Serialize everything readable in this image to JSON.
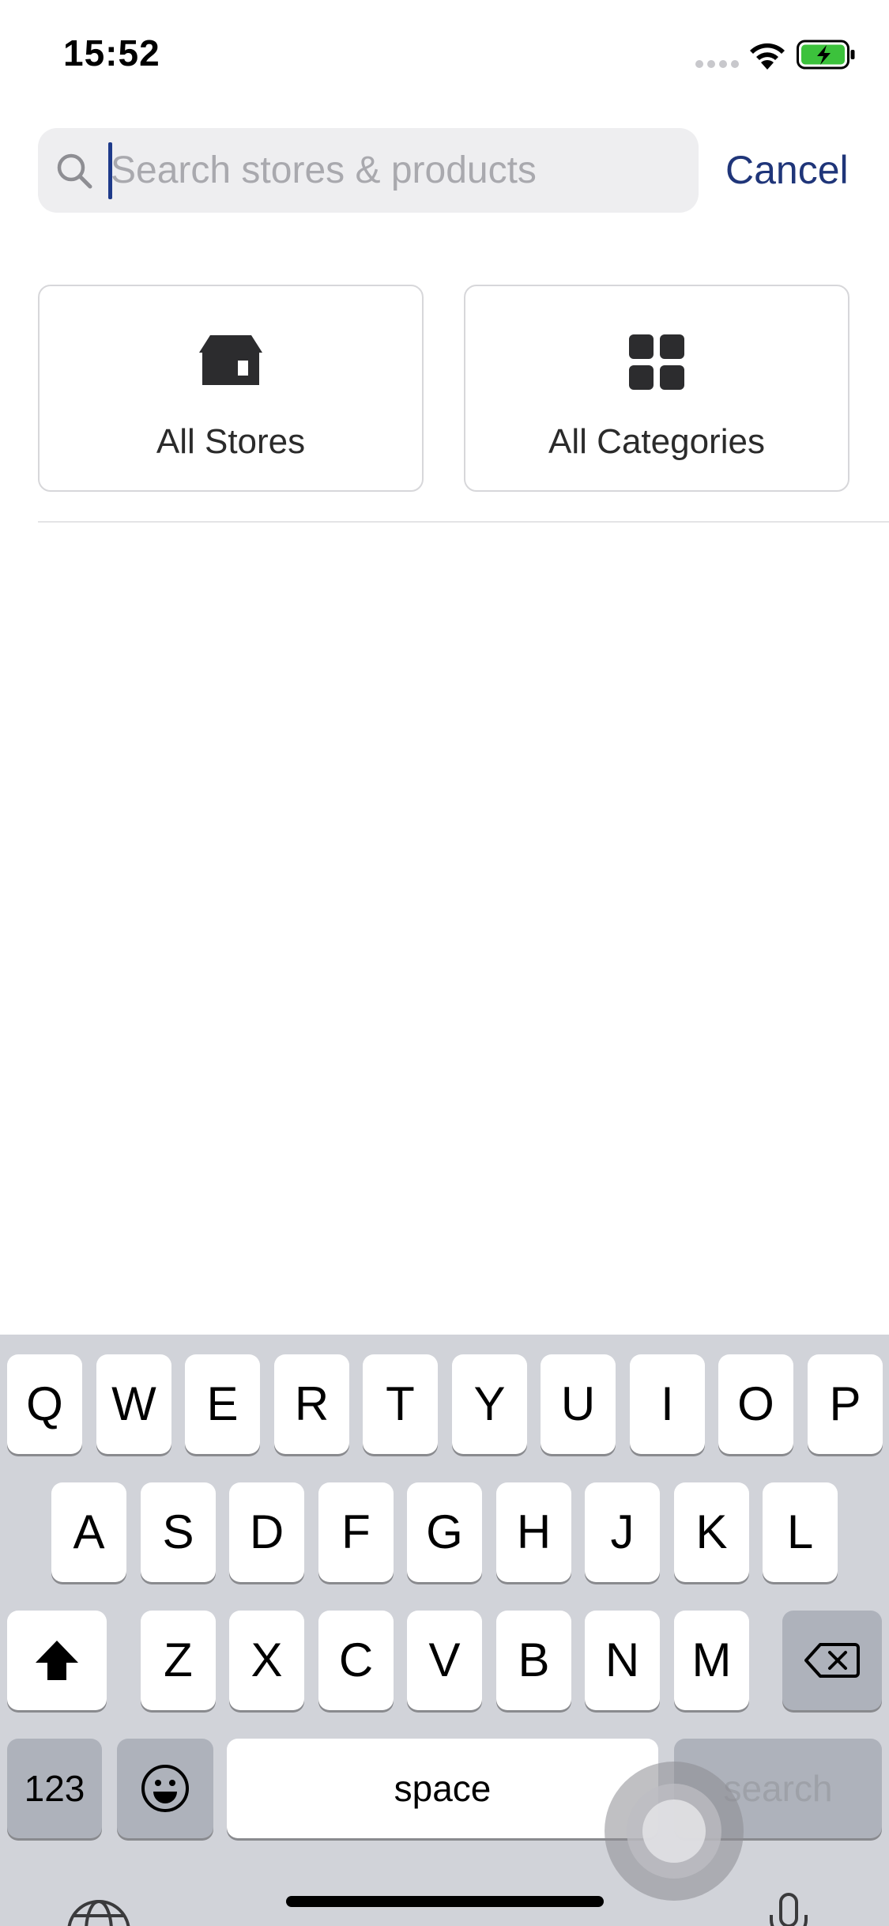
{
  "status_bar": {
    "time": "15:52"
  },
  "search": {
    "placeholder": "Search stores & products",
    "value": "",
    "cancel_label": "Cancel"
  },
  "shortcuts": [
    {
      "label": "All Stores",
      "icon": "store-icon"
    },
    {
      "label": "All Categories",
      "icon": "grid-icon"
    }
  ],
  "keyboard": {
    "row1": [
      "Q",
      "W",
      "E",
      "R",
      "T",
      "Y",
      "U",
      "I",
      "O",
      "P"
    ],
    "row2": [
      "A",
      "S",
      "D",
      "F",
      "G",
      "H",
      "J",
      "K",
      "L"
    ],
    "row3": [
      "Z",
      "X",
      "C",
      "V",
      "B",
      "N",
      "M"
    ],
    "numbers_label": "123",
    "space_label": "space",
    "search_label": "search"
  },
  "colors": {
    "accent": "#1f3579",
    "battery_green": "#3cc23c",
    "keyboard_bg": "#d1d3d9"
  }
}
